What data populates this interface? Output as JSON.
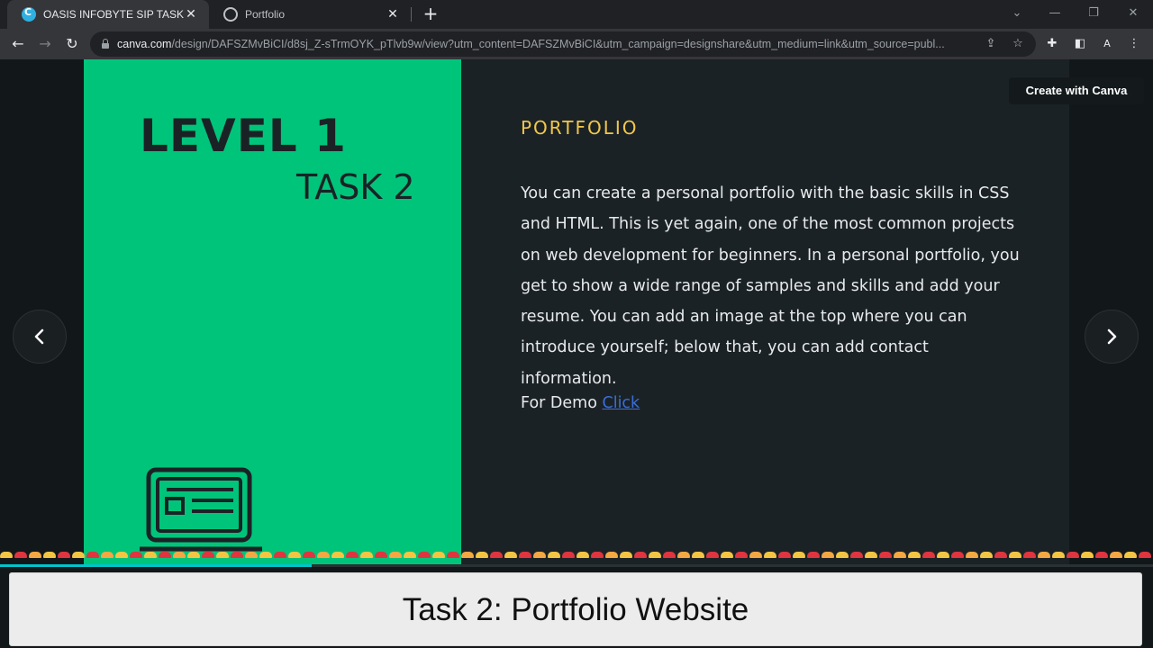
{
  "browser": {
    "tabs": [
      {
        "title": "OASIS INFOBYTE SIP TASK LIST",
        "active": true,
        "favicon": "canva-icon"
      },
      {
        "title": "Portfolio",
        "active": false,
        "favicon": "globe-icon"
      }
    ],
    "url_host": "canva.com",
    "url_path": "/design/DAFSZMvBiCI/d8sj_Z-sTrmOYK_pTlvb9w/view?utm_content=DAFSZMvBiCI&utm_campaign=designshare&utm_medium=link&utm_source=publ...",
    "profile_initial": "A"
  },
  "slide": {
    "level": "LEVEL 1",
    "task": "TASK 2",
    "heading": "PORTFOLIO",
    "body": "You can create a personal portfolio with the basic skills in CSS and HTML. This is yet again, one of the most common projects on web development for beginners. In a personal portfolio, you get to show a wide range of samples and skills and add your resume. You can add an image at the top where you can introduce yourself; below that, you can add contact information.",
    "demo_prefix": "For Demo",
    "demo_link": "Click"
  },
  "viewer": {
    "create_button": "Create with Canva",
    "progress_fraction": 0.27
  },
  "caption": "Task 2: Portfolio Website",
  "colors": {
    "slide_green": "#00c47a",
    "slide_dark": "#1b2226",
    "heading_yellow": "#f2c74a"
  }
}
